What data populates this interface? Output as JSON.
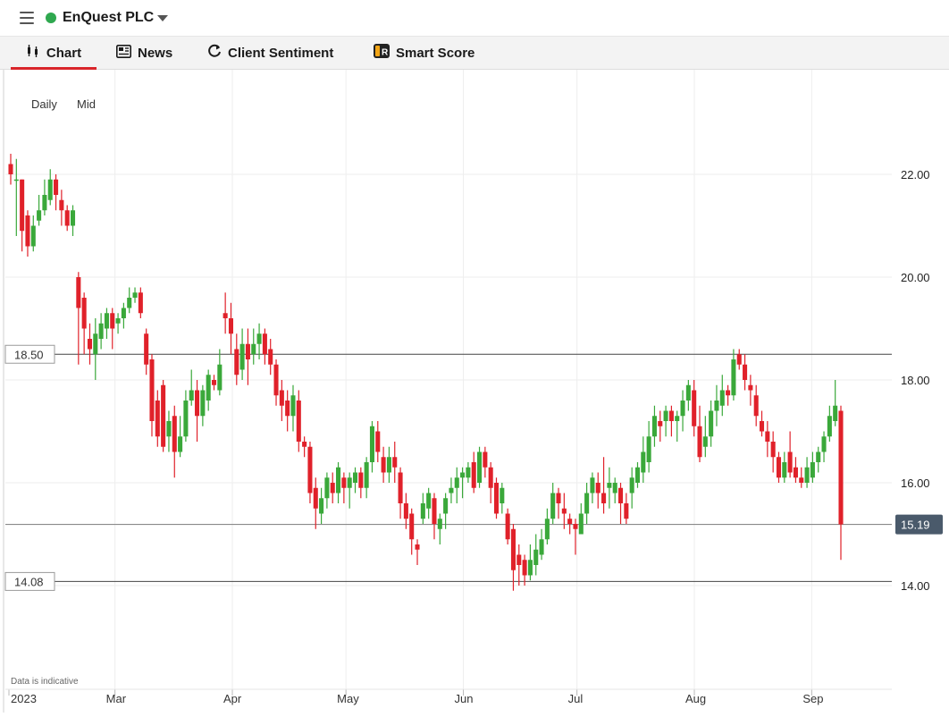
{
  "header": {
    "instrument": "EnQuest PLC",
    "status_color": "#2fa84f"
  },
  "tabs": [
    {
      "label": "Chart",
      "icon": "candlestick-icon",
      "active": true
    },
    {
      "label": "News",
      "icon": "newspaper-icon",
      "active": false
    },
    {
      "label": "Client Sentiment",
      "icon": "refresh-icon",
      "active": false
    },
    {
      "label": "Smart Score",
      "icon": "smart-score-icon",
      "active": false
    }
  ],
  "chart_controls": {
    "interval": "Daily",
    "price_type": "Mid"
  },
  "chart_data": {
    "type": "candlestick",
    "disclaimer": "Data is indicative",
    "up_color": "#3aa83a",
    "down_color": "#e0212a",
    "ylim": [
      12.3,
      24.5
    ],
    "y_ticks": [
      "22.00",
      "20.00",
      "18.00",
      "16.00",
      "14.00"
    ],
    "x_ticks": [
      {
        "label": "2023",
        "date": "2023-02-01"
      },
      {
        "label": "Mar",
        "date": "2023-03-01"
      },
      {
        "label": "Apr",
        "date": "2023-04-01"
      },
      {
        "label": "May",
        "date": "2023-05-01"
      },
      {
        "label": "Jun",
        "date": "2023-06-01"
      },
      {
        "label": "Jul",
        "date": "2023-07-01"
      },
      {
        "label": "Aug",
        "date": "2023-08-01"
      },
      {
        "label": "Sep",
        "date": "2023-09-01"
      }
    ],
    "x_range": [
      "2023-02-01",
      "2023-09-12"
    ],
    "horizontal_lines": [
      {
        "value": 18.5,
        "label": "18.50",
        "side": "left"
      },
      {
        "value": 14.08,
        "label": "14.08",
        "side": "left"
      },
      {
        "value": 15.19,
        "label": "15.19",
        "side": "right",
        "current": true
      }
    ],
    "candles": [
      [
        22.2,
        22.0,
        21.8,
        22.4
      ],
      [
        21.9,
        21.9,
        20.8,
        22.3
      ],
      [
        21.9,
        20.9,
        20.5,
        21.9
      ],
      [
        21.2,
        20.6,
        20.4,
        21.3
      ],
      [
        20.6,
        21.0,
        20.5,
        21.2
      ],
      [
        21.1,
        21.3,
        21.0,
        21.6
      ],
      [
        21.3,
        21.6,
        21.2,
        21.9
      ],
      [
        21.5,
        21.9,
        21.4,
        22.1
      ],
      [
        21.9,
        21.6,
        21.3,
        22.0
      ],
      [
        21.5,
        21.3,
        21.0,
        21.7
      ],
      [
        21.3,
        21.0,
        20.9,
        21.4
      ],
      [
        21.0,
        21.3,
        20.8,
        21.4
      ],
      [
        20.0,
        19.4,
        18.3,
        20.1
      ],
      [
        19.6,
        19.0,
        18.5,
        19.7
      ],
      [
        18.8,
        18.6,
        18.3,
        19.1
      ],
      [
        18.5,
        18.9,
        18.0,
        19.2
      ],
      [
        18.8,
        19.1,
        18.6,
        19.3
      ],
      [
        19.0,
        19.3,
        18.8,
        19.4
      ],
      [
        19.3,
        19.0,
        18.6,
        19.4
      ],
      [
        19.1,
        19.2,
        18.9,
        19.3
      ],
      [
        19.2,
        19.4,
        19.0,
        19.5
      ],
      [
        19.4,
        19.6,
        19.3,
        19.8
      ],
      [
        19.6,
        19.7,
        19.5,
        19.8
      ],
      [
        19.7,
        19.3,
        19.2,
        19.8
      ],
      [
        18.9,
        18.3,
        18.1,
        19.0
      ],
      [
        18.4,
        17.2,
        16.9,
        18.5
      ],
      [
        17.6,
        16.9,
        16.7,
        17.8
      ],
      [
        17.9,
        16.7,
        16.6,
        18.0
      ],
      [
        16.9,
        17.2,
        16.6,
        17.4
      ],
      [
        17.3,
        16.6,
        16.1,
        17.5
      ],
      [
        16.6,
        16.9,
        16.5,
        17.3
      ],
      [
        16.9,
        17.6,
        16.8,
        17.8
      ],
      [
        17.6,
        17.8,
        17.5,
        18.2
      ],
      [
        17.8,
        17.3,
        16.8,
        18.0
      ],
      [
        17.3,
        17.8,
        17.1,
        17.9
      ],
      [
        17.6,
        18.1,
        17.4,
        18.2
      ],
      [
        18.0,
        17.9,
        17.8,
        18.1
      ],
      [
        17.8,
        18.3,
        17.7,
        18.6
      ],
      [
        19.3,
        19.2,
        18.9,
        19.7
      ],
      [
        19.2,
        18.9,
        18.5,
        19.5
      ],
      [
        18.6,
        18.1,
        17.9,
        18.9
      ],
      [
        18.2,
        18.7,
        18.0,
        19.0
      ],
      [
        18.7,
        18.4,
        17.9,
        19.0
      ],
      [
        18.5,
        18.7,
        18.3,
        19.0
      ],
      [
        18.7,
        18.9,
        18.4,
        19.1
      ],
      [
        18.9,
        18.5,
        18.3,
        19.0
      ],
      [
        18.6,
        18.3,
        18.1,
        18.8
      ],
      [
        18.3,
        17.7,
        17.5,
        18.4
      ],
      [
        17.8,
        17.5,
        17.2,
        18.0
      ],
      [
        17.6,
        17.3,
        17.0,
        17.8
      ],
      [
        17.3,
        17.7,
        17.0,
        17.9
      ],
      [
        17.6,
        16.8,
        16.6,
        17.8
      ],
      [
        16.8,
        16.7,
        16.5,
        16.9
      ],
      [
        16.7,
        15.8,
        15.6,
        16.8
      ],
      [
        15.9,
        15.5,
        15.1,
        16.1
      ],
      [
        15.4,
        15.7,
        15.2,
        15.9
      ],
      [
        15.7,
        16.1,
        15.5,
        16.2
      ],
      [
        16.0,
        15.8,
        15.6,
        16.2
      ],
      [
        15.8,
        16.3,
        15.6,
        16.4
      ],
      [
        16.1,
        15.9,
        15.6,
        16.2
      ],
      [
        15.9,
        16.1,
        15.5,
        16.2
      ],
      [
        16.0,
        16.2,
        15.8,
        16.3
      ],
      [
        16.2,
        15.9,
        15.7,
        16.3
      ],
      [
        15.9,
        16.4,
        15.7,
        16.5
      ],
      [
        16.4,
        17.1,
        16.2,
        17.2
      ],
      [
        17.0,
        16.6,
        16.4,
        17.2
      ],
      [
        16.5,
        16.2,
        16.0,
        16.7
      ],
      [
        16.2,
        16.5,
        16.0,
        16.7
      ],
      [
        16.5,
        16.3,
        16.0,
        16.8
      ],
      [
        16.2,
        15.6,
        15.3,
        16.3
      ],
      [
        15.6,
        15.3,
        15.1,
        15.8
      ],
      [
        15.4,
        14.9,
        14.6,
        15.5
      ],
      [
        14.8,
        14.7,
        14.4,
        14.9
      ],
      [
        15.3,
        15.6,
        15.2,
        15.8
      ],
      [
        15.5,
        15.8,
        15.3,
        15.9
      ],
      [
        15.7,
        15.2,
        14.9,
        15.8
      ],
      [
        15.1,
        15.3,
        14.8,
        15.4
      ],
      [
        15.4,
        15.7,
        15.1,
        15.8
      ],
      [
        15.8,
        15.9,
        15.6,
        16.1
      ],
      [
        15.9,
        16.1,
        15.6,
        16.3
      ],
      [
        16.1,
        16.2,
        15.7,
        16.3
      ],
      [
        16.1,
        16.3,
        16.0,
        16.4
      ],
      [
        16.4,
        15.9,
        15.8,
        16.6
      ],
      [
        16.0,
        16.6,
        15.9,
        16.7
      ],
      [
        16.6,
        16.3,
        16.1,
        16.7
      ],
      [
        16.3,
        15.9,
        15.6,
        16.4
      ],
      [
        16.0,
        15.4,
        15.3,
        16.1
      ],
      [
        15.6,
        15.9,
        15.4,
        16.0
      ],
      [
        15.4,
        14.9,
        14.8,
        15.5
      ],
      [
        15.1,
        14.3,
        13.9,
        15.2
      ],
      [
        14.6,
        14.4,
        14.0,
        14.8
      ],
      [
        14.5,
        14.2,
        14.0,
        14.6
      ],
      [
        14.2,
        14.5,
        14.1,
        14.8
      ],
      [
        14.4,
        14.7,
        14.2,
        15.0
      ],
      [
        14.6,
        14.9,
        14.5,
        15.1
      ],
      [
        14.9,
        15.3,
        14.8,
        15.5
      ],
      [
        15.3,
        15.8,
        15.2,
        16.0
      ],
      [
        15.8,
        15.6,
        15.3,
        15.9
      ],
      [
        15.5,
        15.4,
        15.1,
        15.8
      ],
      [
        15.3,
        15.2,
        15.0,
        15.4
      ],
      [
        15.2,
        15.1,
        14.6,
        15.3
      ],
      [
        15.0,
        15.4,
        15.0,
        15.6
      ],
      [
        15.4,
        15.8,
        15.2,
        16.0
      ],
      [
        15.8,
        16.1,
        15.6,
        16.2
      ],
      [
        16.0,
        15.8,
        15.5,
        16.2
      ],
      [
        15.8,
        15.6,
        15.4,
        16.5
      ],
      [
        15.9,
        16.0,
        15.5,
        16.3
      ],
      [
        15.8,
        16.0,
        15.6,
        16.1
      ],
      [
        15.9,
        15.6,
        15.2,
        16.0
      ],
      [
        15.6,
        15.3,
        15.2,
        15.8
      ],
      [
        15.8,
        16.1,
        15.5,
        16.3
      ],
      [
        16.0,
        16.3,
        15.9,
        16.4
      ],
      [
        16.2,
        16.6,
        16.0,
        16.9
      ],
      [
        16.4,
        16.9,
        16.2,
        17.2
      ],
      [
        16.9,
        17.3,
        16.7,
        17.5
      ],
      [
        17.2,
        17.1,
        16.8,
        17.4
      ],
      [
        17.2,
        17.4,
        16.9,
        17.5
      ],
      [
        17.4,
        17.2,
        16.9,
        17.5
      ],
      [
        17.2,
        17.3,
        16.8,
        17.4
      ],
      [
        17.3,
        17.6,
        17.0,
        17.8
      ],
      [
        17.6,
        17.9,
        17.4,
        18.0
      ],
      [
        17.8,
        17.1,
        16.9,
        18.0
      ],
      [
        17.1,
        16.5,
        16.4,
        17.5
      ],
      [
        16.7,
        16.9,
        16.5,
        17.3
      ],
      [
        16.9,
        17.4,
        16.7,
        17.6
      ],
      [
        17.4,
        17.6,
        17.1,
        17.9
      ],
      [
        17.5,
        17.8,
        17.3,
        18.1
      ],
      [
        17.8,
        17.7,
        17.5,
        17.9
      ],
      [
        17.7,
        18.4,
        17.6,
        18.6
      ],
      [
        18.5,
        18.3,
        18.2,
        18.6
      ],
      [
        18.3,
        18.0,
        17.8,
        18.5
      ],
      [
        17.9,
        17.8,
        17.5,
        18.1
      ],
      [
        17.7,
        17.3,
        17.1,
        17.9
      ],
      [
        17.2,
        17.0,
        16.9,
        17.4
      ],
      [
        17.0,
        16.8,
        16.5,
        17.2
      ],
      [
        16.8,
        16.5,
        16.2,
        17.0
      ],
      [
        16.5,
        16.1,
        16.0,
        16.6
      ],
      [
        16.1,
        16.4,
        16.0,
        16.6
      ],
      [
        16.6,
        16.2,
        16.1,
        17.0
      ],
      [
        16.3,
        16.1,
        16.0,
        16.5
      ],
      [
        16.1,
        16.0,
        15.9,
        16.3
      ],
      [
        16.0,
        16.3,
        15.9,
        16.5
      ],
      [
        16.1,
        16.4,
        16.0,
        16.6
      ],
      [
        16.4,
        16.6,
        16.2,
        16.7
      ],
      [
        16.6,
        16.9,
        16.4,
        17.0
      ],
      [
        16.9,
        17.3,
        16.8,
        17.5
      ],
      [
        17.2,
        17.5,
        17.1,
        18.0
      ],
      [
        17.4,
        15.19,
        14.5,
        17.5
      ]
    ]
  }
}
